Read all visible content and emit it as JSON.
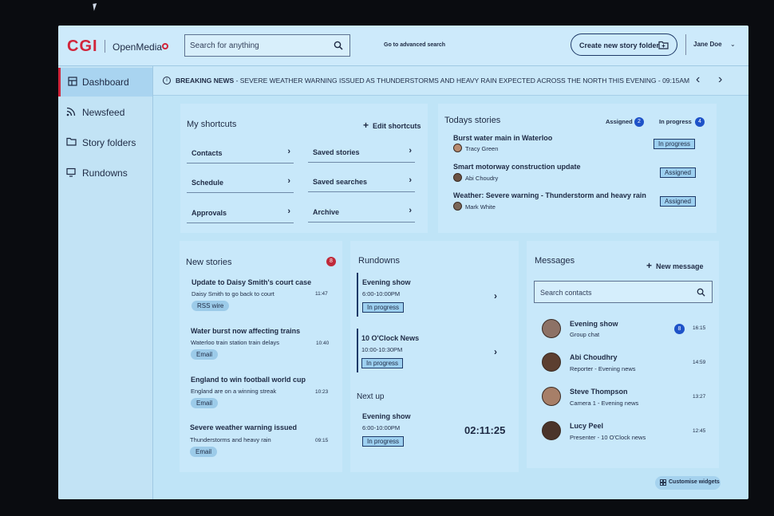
{
  "header": {
    "logo": "CGI",
    "app_name": "OpenMedia",
    "search_placeholder": "Search for anything",
    "advanced_search": "Go to advanced search",
    "create_button": "Create new story folder",
    "user_name": "Jane Doe"
  },
  "sidebar": {
    "items": [
      {
        "label": "Dashboard",
        "icon": "dashboard-icon"
      },
      {
        "label": "Newsfeed",
        "icon": "rss-icon"
      },
      {
        "label": "Story folders",
        "icon": "folder-icon"
      },
      {
        "label": "Rundowns",
        "icon": "monitor-icon"
      }
    ]
  },
  "breaking": {
    "label": "BREAKING NEWS",
    "text": "- SEVERE WEATHER WARNING ISSUED AS THUNDERSTORMS AND HEAVY RAIN EXPECTED ACROSS THE NORTH  THIS EVENING - 09:15AM"
  },
  "shortcuts": {
    "title": "My shortcuts",
    "edit": "Edit shortcuts",
    "items": [
      "Contacts",
      "Saved stories",
      "Schedule",
      "Saved searches",
      "Approvals",
      "Archive"
    ]
  },
  "today": {
    "title": "Todays stories",
    "assigned_label": "Assigned",
    "assigned_count": "2",
    "inprogress_label": "In progress",
    "inprogress_count": "4",
    "stories": [
      {
        "title": "Burst water main in Waterloo",
        "person": "Tracy Green",
        "status": "In progress"
      },
      {
        "title": "Smart motorway construction update",
        "person": "Abi Choudry",
        "status": "Assigned"
      },
      {
        "title": "Weather: Severe warning - Thunderstorm and heavy rain",
        "person": "Mark White",
        "status": "Assigned"
      }
    ]
  },
  "new_stories": {
    "title": "New stories",
    "count": "8",
    "items": [
      {
        "title": "Update to Daisy Smith's court case",
        "sub": "Daisy Smith to go back to court",
        "time": "11:47",
        "tag": "RSS wire"
      },
      {
        "title": "Water burst now affecting trains",
        "sub": "Waterloo train station train delays",
        "time": "10:40",
        "tag": "Email"
      },
      {
        "title": "England to win football world cup",
        "sub": "England are on a winning streak",
        "time": "10:23",
        "tag": "Email"
      },
      {
        "title": "Severe weather warning issued",
        "sub": "Thunderstorms and heavy rain",
        "time": "09:15",
        "tag": "Email"
      }
    ]
  },
  "rundowns": {
    "title": "Rundowns",
    "items": [
      {
        "name": "Evening show",
        "time": "6:00-10:00PM",
        "status": "In progress"
      },
      {
        "name": "10 O'Clock News",
        "time": "10:00-10:30PM",
        "status": "In progress"
      }
    ],
    "next_up_label": "Next up",
    "next_up": {
      "name": "Evening show",
      "time": "6:00-10:00PM",
      "status": "In progress",
      "countdown": "02:11:25"
    }
  },
  "messages": {
    "title": "Messages",
    "new": "New message",
    "search_placeholder": "Search contacts",
    "items": [
      {
        "name": "Evening show",
        "sub": "Group chat",
        "time": "16:15",
        "badge": "8"
      },
      {
        "name": "Abi Choudhry",
        "sub": "Reporter - Evening news",
        "time": "14:59"
      },
      {
        "name": "Steve Thompson",
        "sub": "Camera 1 - Evening news",
        "time": "13:27"
      },
      {
        "name": "Lucy Peel",
        "sub": "Presenter - 10 O'Clock news",
        "time": "12:45"
      }
    ]
  },
  "customise": "Customise widgets",
  "colors": {
    "brand": "#d1253b",
    "accent": "#1e52c8",
    "text": "#1e2a44"
  }
}
